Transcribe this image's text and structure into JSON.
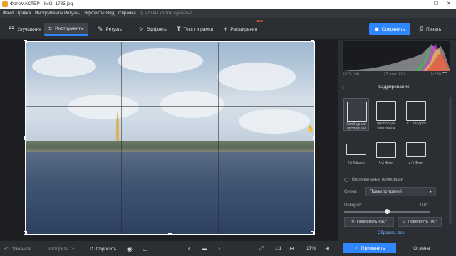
{
  "window": {
    "title": "ФотоМАСТЕР - IMG_1735.jpg",
    "minimize": "—",
    "maximize": "☐",
    "close": "✕"
  },
  "menu": {
    "items": [
      "Файл",
      "Правка",
      "Инструменты",
      "Ретушь",
      "Эффекты",
      "Вид",
      "Справка"
    ],
    "search_placeholder": "Что вы хотите сделать?"
  },
  "toolbar": {
    "tools": [
      "Улучшения",
      "Инструменты",
      "Ретушь",
      "Эффекты",
      "Текст и рамки",
      "Расширения"
    ],
    "new_badge": "NEW",
    "save_label": "Сохранить",
    "print_label": "Печать"
  },
  "bottom": {
    "undo": "Отменить",
    "redo": "Повторить",
    "reset": "Сбросить",
    "ratio_1_1": "1:1",
    "zoom": "17%"
  },
  "histogram": {
    "iso": "ISO 100",
    "focal": "27 mm f/10",
    "shutter": "1/250"
  },
  "crop_panel": {
    "title": "Кадрирование",
    "ratios": [
      {
        "label": "Свободные пропорции"
      },
      {
        "label": "Пропорции оригинала"
      },
      {
        "label": "1:1 Квадрат"
      },
      {
        "label": "16:9 Кино"
      },
      {
        "label": "5:4 Фото"
      },
      {
        "label": "4:3 Фото"
      }
    ],
    "vertical_label": "Вертикальные пропорции",
    "grid_label": "Сетка:",
    "grid_value": "Правило третей",
    "rotate_label": "Поворот:",
    "rotate_value": "0,0°",
    "rotate_left": "Повернуть +90°",
    "rotate_right": "Повернуть -90°",
    "reset_all": "Сбросить все",
    "apply": "Применить",
    "cancel": "Отмена"
  },
  "colors": {
    "accent": "#2f86ff",
    "background": "#2b2e33"
  }
}
